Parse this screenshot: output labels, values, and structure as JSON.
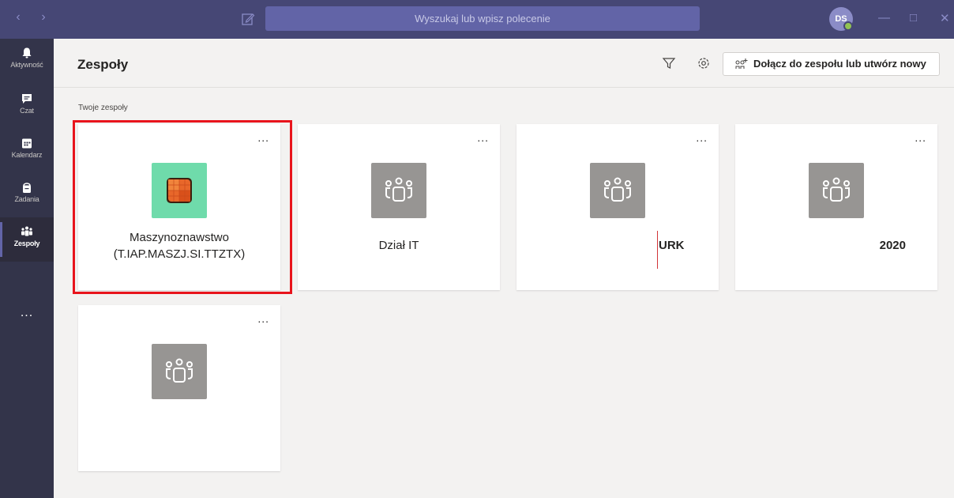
{
  "titlebar": {
    "search_placeholder": "Wyszukaj lub wpisz polecenie",
    "avatar_initials": "DS",
    "presence_color": "#92c353"
  },
  "sidebar": {
    "items": [
      {
        "label": "Aktywność",
        "icon": "bell-icon"
      },
      {
        "label": "Czat",
        "icon": "chat-icon"
      },
      {
        "label": "Kalendarz",
        "icon": "calendar-icon"
      },
      {
        "label": "Zadania",
        "icon": "assignments-icon"
      },
      {
        "label": "Zespoły",
        "icon": "teams-icon",
        "active": true
      }
    ],
    "more": "..."
  },
  "header": {
    "title": "Zespoły",
    "join_button": "Dołącz do zespołu lub utwórz nowy"
  },
  "section": {
    "label": "Twoje zespoły"
  },
  "teams": [
    {
      "name_line1": "Maszynoznawstwo",
      "name_line2": "(T.IAP.MASZJ.SI.TTZTX)",
      "tile": "custom-orange-grid",
      "tile_color": "#6fdbab",
      "selected": true
    },
    {
      "name": "Dział IT",
      "tile": "people-icon",
      "tile_color": "#979593"
    },
    {
      "name": "URK",
      "tile": "people-icon",
      "tile_color": "#979593"
    },
    {
      "name": "2020",
      "tile": "people-icon",
      "tile_color": "#979593"
    },
    {
      "name": "",
      "tile": "people-icon",
      "tile_color": "#979593"
    }
  ],
  "card_more": "...",
  "colors": {
    "brand": "#464775",
    "accent": "#6264a7",
    "highlight": "#e8141c"
  }
}
